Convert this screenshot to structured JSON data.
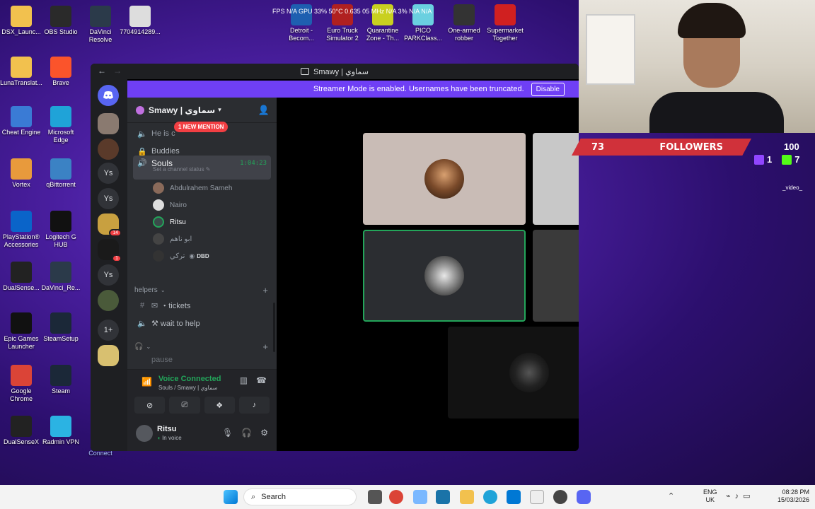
{
  "desktop": {
    "icons": [
      {
        "label": "DSX_Launc...",
        "color": "#f2c14e"
      },
      {
        "label": "OBS Studio",
        "color": "#2a2a2a"
      },
      {
        "label": "DaVinci Resolve",
        "color": "#2b3a4a"
      },
      {
        "label": "7704914289...",
        "color": "#ddd"
      },
      {
        "label": "LunaTranslat...",
        "color": "#f2c14e"
      },
      {
        "label": "Brave",
        "color": "#fb542b"
      },
      {
        "label": "Cheat Engine",
        "color": "#3a7bd5"
      },
      {
        "label": "Microsoft Edge",
        "color": "#1fa3d8"
      },
      {
        "label": "Vortex",
        "color": "#e89a3c"
      },
      {
        "label": "qBittorrent",
        "color": "#3b82c4"
      },
      {
        "label": "PlayStation® Accessories",
        "color": "#0a64c9"
      },
      {
        "label": "Logitech G HUB",
        "color": "#111"
      },
      {
        "label": "DualSense...",
        "color": "#222"
      },
      {
        "label": "DaVinci_Re...",
        "color": "#2b3a4a"
      },
      {
        "label": "Epic Games Launcher",
        "color": "#111"
      },
      {
        "label": "SteamSetup",
        "color": "#1b2838"
      },
      {
        "label": "Google Chrome",
        "color": "#db4437"
      },
      {
        "label": "Steam",
        "color": "#1b2838"
      },
      {
        "label": "DualSenseX",
        "color": "#222"
      },
      {
        "label": "Radmin VPN",
        "color": "#2bb3e3"
      }
    ],
    "top_games": [
      {
        "label": "Detroit - Becom...",
        "color": "#1e5fb0"
      },
      {
        "label": "Euro Truck Simulator 2",
        "color": "#b02020"
      },
      {
        "label": "Quarantine Zone - Th...",
        "color": "#c9d020"
      },
      {
        "label": "PICO PARKClass...",
        "color": "#6ad0e0"
      },
      {
        "label": "One-armed robber",
        "color": "#333"
      },
      {
        "label": "Supermarket Together",
        "color": "#d02020"
      }
    ],
    "fps_text": "FPS N/A GPU 33% 50°C 0.635 05 MHz N/A 3% N/A N/A",
    "connect_label": "Connect"
  },
  "discord": {
    "window_title": "Smawy | سماوي",
    "back_glyph": "←",
    "forward_glyph": "→",
    "streamer_bar": {
      "text": "Streamer Mode is enabled. Usernames have been truncated.",
      "button": "Disable"
    },
    "rail": {
      "items": [
        "Ys",
        "Ys",
        "Ys",
        "1+"
      ],
      "badges": [
        "14",
        "1"
      ]
    },
    "server": {
      "name": "Smawy | سماوي",
      "channels": {
        "he_is": "He is c",
        "mention": "1 NEW MENTION",
        "buddies": "Buddies",
        "souls": "Souls",
        "souls_timer": "1:04:23",
        "set_status": "Set a channel status",
        "tickets": "・tickets",
        "wait_help": "⚒ wait to help",
        "pause": "pause"
      },
      "voice_users": [
        "Abdulrahem Sameh",
        "Nairo",
        "Ritsu",
        "ابو ناهم",
        "تركي"
      ],
      "dbd_tag": "DBD",
      "category": "helpers"
    },
    "voice_panel": {
      "title": "Voice Connected",
      "subtitle": "Souls / Smawy | سماوي"
    },
    "user": {
      "name": "Ritsu",
      "status": "In voice"
    }
  },
  "stream_overlay": {
    "followers_count": "73",
    "followers_label": "FOLLOWERS",
    "hundred": "100",
    "twitch_count": "1",
    "kick_count": "7",
    "video_label": "_video_"
  },
  "taskbar": {
    "search_placeholder": "Search",
    "lang_top": "ENG",
    "lang_bottom": "UK",
    "time": "08:28 PM",
    "date": "15/03/2026"
  }
}
